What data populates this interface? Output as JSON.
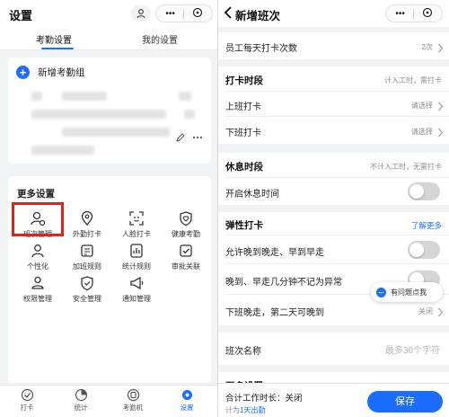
{
  "left": {
    "title": "设置",
    "caps_dots": "•••",
    "tabs": [
      {
        "label": "考勤设置",
        "active": true
      },
      {
        "label": "我的设置",
        "active": false
      }
    ],
    "add_group_label": "新增考勤组",
    "more_title": "更多设置",
    "grid_items": [
      {
        "label": "班次管理",
        "icon": "shift-management-icon"
      },
      {
        "label": "外勤打卡",
        "icon": "location-pin-icon"
      },
      {
        "label": "人脸打卡",
        "icon": "face-scan-icon"
      },
      {
        "label": "健康考勤",
        "icon": "heart-shield-icon"
      },
      {
        "label": "个性化",
        "icon": "personalize-icon"
      },
      {
        "label": "加班规则",
        "icon": "overtime-rule-icon"
      },
      {
        "label": "统计规则",
        "icon": "statistics-rule-icon"
      },
      {
        "label": "审批关联",
        "icon": "approval-link-icon"
      },
      {
        "label": "权限管理",
        "icon": "permission-icon"
      },
      {
        "label": "安全管理",
        "icon": "security-shield-icon"
      },
      {
        "label": "通知管理",
        "icon": "notification-megaphone-icon"
      }
    ],
    "tabbar": [
      {
        "label": "打卡",
        "icon": "checkin-icon",
        "active": false
      },
      {
        "label": "统计",
        "icon": "statistics-icon",
        "active": false
      },
      {
        "label": "考勤机",
        "icon": "attendance-machine-icon",
        "active": false
      },
      {
        "label": "设置",
        "icon": "settings-gear-icon",
        "active": true
      }
    ],
    "accent_color": "#1a6dff",
    "highlight_color": "#d9251c"
  },
  "right": {
    "title": "新增班次",
    "caps_dots": "•••",
    "daily_checkins": {
      "label": "员工每天打卡次数",
      "value": "2次"
    },
    "checkin_period": {
      "label": "打卡时段",
      "hint": "计入工时，需打卡"
    },
    "work_start": {
      "label": "上班打卡",
      "value": "请选择"
    },
    "work_end": {
      "label": "下班打卡",
      "value": "请选择"
    },
    "rest_period": {
      "label": "休息时段",
      "hint": "不计入工时，无需打卡"
    },
    "enable_rest": {
      "label": "开启休息时间",
      "on": false
    },
    "flex_checkin": {
      "label": "弹性打卡",
      "link": "了解更多"
    },
    "late_in_late_out": {
      "label": "允许晚到晚走、早到早走",
      "on": false
    },
    "grace_minutes": {
      "label": "晚到、早走几分钟不记为异常",
      "on": false
    },
    "late_next_day": {
      "label": "下班晚走，第二天可晚到",
      "value": "关闭"
    },
    "shift_name": {
      "label": "班次名称",
      "placeholder": "最多30个字符"
    },
    "more_settings": {
      "label": "更多设置"
    },
    "question_pill": "有问题点我",
    "footer": {
      "total_hours_label": "合计工作时长：关闭",
      "count_prefix": "计为",
      "count_link": "1天出勤",
      "save_label": "保存"
    }
  }
}
